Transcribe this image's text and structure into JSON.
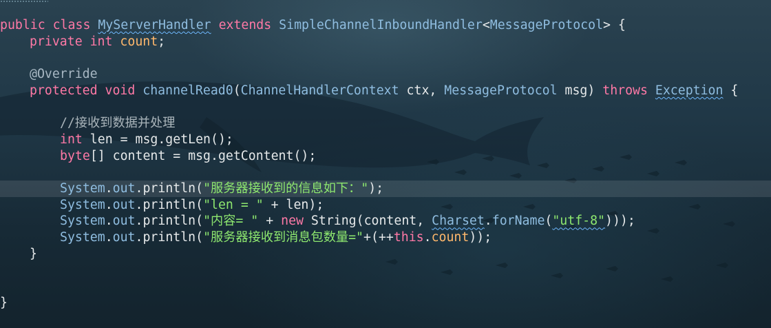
{
  "editor": {
    "highlighted_line": 11,
    "lines": [
      {
        "indent": 0,
        "tokens": [
          {
            "t": "public",
            "c": "kw"
          },
          {
            "t": " ",
            "c": "plain"
          },
          {
            "t": "class",
            "c": "kw"
          },
          {
            "t": " ",
            "c": "plain"
          },
          {
            "t": "MyServerHandler",
            "c": "type",
            "w": true
          },
          {
            "t": " ",
            "c": "plain"
          },
          {
            "t": "extends",
            "c": "kw"
          },
          {
            "t": " ",
            "c": "plain"
          },
          {
            "t": "SimpleChannelInboundHandler",
            "c": "type"
          },
          {
            "t": "<",
            "c": "plain"
          },
          {
            "t": "MessageProtocol",
            "c": "type"
          },
          {
            "t": "> {",
            "c": "plain"
          }
        ]
      },
      {
        "indent": 1,
        "tokens": [
          {
            "t": "private",
            "c": "kw"
          },
          {
            "t": " ",
            "c": "plain"
          },
          {
            "t": "int",
            "c": "kw"
          },
          {
            "t": " ",
            "c": "plain"
          },
          {
            "t": "count",
            "c": "field"
          },
          {
            "t": ";",
            "c": "plain"
          }
        ]
      },
      {
        "indent": 0,
        "tokens": []
      },
      {
        "indent": 1,
        "tokens": [
          {
            "t": "@Override",
            "c": "ann"
          }
        ]
      },
      {
        "indent": 1,
        "tokens": [
          {
            "t": "protected",
            "c": "kw"
          },
          {
            "t": " ",
            "c": "plain"
          },
          {
            "t": "void",
            "c": "kw"
          },
          {
            "t": " ",
            "c": "plain"
          },
          {
            "t": "channelRead0",
            "c": "type"
          },
          {
            "t": "(",
            "c": "plain"
          },
          {
            "t": "ChannelHandlerContext",
            "c": "type"
          },
          {
            "t": " ctx, ",
            "c": "plain"
          },
          {
            "t": "MessageProtocol",
            "c": "type"
          },
          {
            "t": " msg) ",
            "c": "plain"
          },
          {
            "t": "throws",
            "c": "kw"
          },
          {
            "t": " ",
            "c": "plain"
          },
          {
            "t": "Exception",
            "c": "type",
            "w": true
          },
          {
            "t": " {",
            "c": "plain"
          }
        ]
      },
      {
        "indent": 0,
        "tokens": []
      },
      {
        "indent": 2,
        "tokens": [
          {
            "t": "//接收到数据并处理",
            "c": "comment"
          }
        ]
      },
      {
        "indent": 2,
        "tokens": [
          {
            "t": "int",
            "c": "kw"
          },
          {
            "t": " len = msg.getLen();",
            "c": "plain"
          }
        ]
      },
      {
        "indent": 2,
        "tokens": [
          {
            "t": "byte",
            "c": "kw"
          },
          {
            "t": "[] content = msg.getContent();",
            "c": "plain"
          }
        ]
      },
      {
        "indent": 0,
        "tokens": []
      },
      {
        "indent": 2,
        "tokens": [
          {
            "t": "System",
            "c": "type"
          },
          {
            "t": ".",
            "c": "plain"
          },
          {
            "t": "out",
            "c": "type"
          },
          {
            "t": ".println(",
            "c": "plain"
          },
          {
            "t": "\"服务器接收到的信息如下：\"",
            "c": "str"
          },
          {
            "t": ");",
            "c": "plain"
          }
        ]
      },
      {
        "indent": 2,
        "tokens": [
          {
            "t": "System",
            "c": "type"
          },
          {
            "t": ".",
            "c": "plain"
          },
          {
            "t": "out",
            "c": "type"
          },
          {
            "t": ".println(",
            "c": "plain"
          },
          {
            "t": "\"len = \"",
            "c": "str"
          },
          {
            "t": " + len);",
            "c": "plain"
          }
        ]
      },
      {
        "indent": 2,
        "tokens": [
          {
            "t": "System",
            "c": "type"
          },
          {
            "t": ".",
            "c": "plain"
          },
          {
            "t": "out",
            "c": "type"
          },
          {
            "t": ".println(",
            "c": "plain"
          },
          {
            "t": "\"内容= \"",
            "c": "str"
          },
          {
            "t": " + ",
            "c": "plain"
          },
          {
            "t": "new",
            "c": "kw"
          },
          {
            "t": " String(content, ",
            "c": "plain"
          },
          {
            "t": "Charset",
            "c": "type",
            "w": true
          },
          {
            "t": ".",
            "c": "plain"
          },
          {
            "t": "forName",
            "c": "type"
          },
          {
            "t": "(",
            "c": "plain"
          },
          {
            "t": "\"utf-8\"",
            "c": "str",
            "w": true
          },
          {
            "t": ")));",
            "c": "plain"
          }
        ]
      },
      {
        "indent": 2,
        "tokens": [
          {
            "t": "System",
            "c": "type"
          },
          {
            "t": ".",
            "c": "plain"
          },
          {
            "t": "out",
            "c": "type"
          },
          {
            "t": ".println(",
            "c": "plain"
          },
          {
            "t": "\"服务器接收到消息包数量=\"",
            "c": "str"
          },
          {
            "t": "+(++",
            "c": "plain"
          },
          {
            "t": "this",
            "c": "kw"
          },
          {
            "t": ".",
            "c": "plain"
          },
          {
            "t": "count",
            "c": "field"
          },
          {
            "t": "));",
            "c": "plain"
          }
        ]
      },
      {
        "indent": 1,
        "tokens": [
          {
            "t": "}",
            "c": "plain"
          }
        ]
      },
      {
        "indent": 0,
        "tokens": []
      },
      {
        "indent": 0,
        "tokens": []
      },
      {
        "indent": 0,
        "tokens": [
          {
            "t": "}",
            "c": "plain"
          }
        ]
      }
    ]
  },
  "colors": {
    "keyword": "#ff79a6",
    "type": "#8fbde0",
    "string": "#8ee86f",
    "field": "#ffb86c",
    "comment": "#a9b4ba",
    "text": "#e6e9ea",
    "background": "#1b2e3a"
  }
}
